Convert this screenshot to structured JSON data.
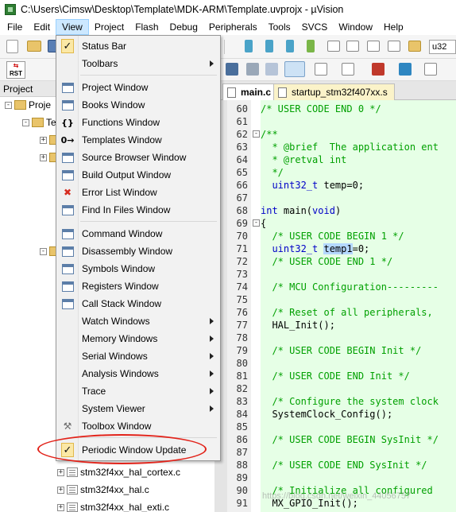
{
  "window": {
    "title": "C:\\Users\\Cimsw\\Desktop\\Template\\MDK-ARM\\Template.uvprojx - µVision"
  },
  "menubar": [
    "File",
    "Edit",
    "View",
    "Project",
    "Flash",
    "Debug",
    "Peripherals",
    "Tools",
    "SVCS",
    "Window",
    "Help"
  ],
  "toolbar": {
    "target_combo": "u32",
    "rst_label": "RST"
  },
  "project_panel": {
    "header": "Project",
    "tree": [
      {
        "label": "Proje",
        "indent": 0,
        "expander": "-"
      },
      {
        "label": "Te",
        "indent": 1,
        "expander": "-"
      },
      {
        "label": "",
        "indent": 2,
        "expander": "+"
      },
      {
        "label": "",
        "indent": 2,
        "expander": "+"
      },
      {
        "label": "",
        "indent": 2,
        "expander": "-"
      },
      {
        "label": "stm32f4xx_hal_cortex.c",
        "indent": 3,
        "expander": "+"
      },
      {
        "label": "stm32f4xx_hal.c",
        "indent": 3,
        "expander": "+"
      },
      {
        "label": "stm32f4xx_hal_exti.c",
        "indent": 3,
        "expander": "+"
      }
    ]
  },
  "tabs": [
    {
      "label": "main.c",
      "active": true
    },
    {
      "label": "startup_stm32f407xx.s",
      "active": false
    }
  ],
  "code": [
    {
      "n": "60",
      "fold": "",
      "parts": [
        [
          "comment",
          "/* USER CODE END 0 */"
        ]
      ]
    },
    {
      "n": "61",
      "fold": "",
      "parts": []
    },
    {
      "n": "62",
      "fold": "-",
      "parts": [
        [
          "comment",
          "/**"
        ]
      ]
    },
    {
      "n": "63",
      "fold": "",
      "parts": [
        [
          "comment",
          "  * @brief  The application ent"
        ]
      ]
    },
    {
      "n": "64",
      "fold": "",
      "parts": [
        [
          "comment",
          "  * @retval int"
        ]
      ]
    },
    {
      "n": "65",
      "fold": "",
      "parts": [
        [
          "comment",
          "  */"
        ]
      ]
    },
    {
      "n": "66",
      "fold": "",
      "parts": [
        [
          "kw",
          "  uint32_t"
        ],
        [
          "plain",
          " temp=0;"
        ]
      ]
    },
    {
      "n": "67",
      "fold": "",
      "parts": []
    },
    {
      "n": "68",
      "fold": "",
      "parts": [
        [
          "kw",
          "int"
        ],
        [
          "plain",
          " main("
        ],
        [
          "kw",
          "void"
        ],
        [
          "plain",
          ")"
        ]
      ]
    },
    {
      "n": "69",
      "fold": "-",
      "parts": [
        [
          "plain",
          "{"
        ]
      ]
    },
    {
      "n": "70",
      "fold": "",
      "parts": [
        [
          "comment",
          "  /* USER CODE BEGIN 1 */"
        ]
      ]
    },
    {
      "n": "71",
      "fold": "",
      "parts": [
        [
          "kw",
          "  uint32_t"
        ],
        [
          "plain",
          " "
        ],
        [
          "hl",
          "temp1"
        ],
        [
          "plain",
          "=0;"
        ]
      ]
    },
    {
      "n": "72",
      "fold": "",
      "parts": [
        [
          "comment",
          "  /* USER CODE END 1 */"
        ]
      ]
    },
    {
      "n": "73",
      "fold": "",
      "parts": []
    },
    {
      "n": "74",
      "fold": "",
      "parts": [
        [
          "comment",
          "  /* MCU Configuration---------"
        ]
      ]
    },
    {
      "n": "75",
      "fold": "",
      "parts": []
    },
    {
      "n": "76",
      "fold": "",
      "parts": [
        [
          "comment",
          "  /* Reset of all peripherals,"
        ]
      ]
    },
    {
      "n": "77",
      "fold": "",
      "parts": [
        [
          "plain",
          "  HAL_Init();"
        ]
      ]
    },
    {
      "n": "78",
      "fold": "",
      "parts": []
    },
    {
      "n": "79",
      "fold": "",
      "parts": [
        [
          "comment",
          "  /* USER CODE BEGIN Init */"
        ]
      ]
    },
    {
      "n": "80",
      "fold": "",
      "parts": []
    },
    {
      "n": "81",
      "fold": "",
      "parts": [
        [
          "comment",
          "  /* USER CODE END Init */"
        ]
      ]
    },
    {
      "n": "82",
      "fold": "",
      "parts": []
    },
    {
      "n": "83",
      "fold": "",
      "parts": [
        [
          "comment",
          "  /* Configure the system clock"
        ]
      ]
    },
    {
      "n": "84",
      "fold": "",
      "parts": [
        [
          "plain",
          "  SystemClock_Config();"
        ]
      ]
    },
    {
      "n": "85",
      "fold": "",
      "parts": []
    },
    {
      "n": "86",
      "fold": "",
      "parts": [
        [
          "comment",
          "  /* USER CODE BEGIN SysInit */"
        ]
      ]
    },
    {
      "n": "87",
      "fold": "",
      "parts": []
    },
    {
      "n": "88",
      "fold": "",
      "parts": [
        [
          "comment",
          "  /* USER CODE END SysInit */"
        ]
      ]
    },
    {
      "n": "89",
      "fold": "",
      "parts": []
    },
    {
      "n": "90",
      "fold": "",
      "parts": [
        [
          "comment",
          "  /* Initialize all configured"
        ]
      ]
    },
    {
      "n": "91",
      "fold": "",
      "parts": [
        [
          "plain",
          "  MX_GPIO_Init();"
        ]
      ]
    }
  ],
  "view_menu": {
    "items": [
      {
        "label": "Status Bar",
        "icon": "check-icon",
        "checked": true,
        "submenu": false
      },
      {
        "label": "Toolbars",
        "icon": "",
        "checked": false,
        "submenu": true
      },
      {
        "sep": true
      },
      {
        "label": "Project Window",
        "icon": "project-window-icon",
        "submenu": false
      },
      {
        "label": "Books Window",
        "icon": "books-window-icon",
        "submenu": false
      },
      {
        "label": "Functions Window",
        "icon": "functions-window-icon",
        "glyph": "{}",
        "submenu": false
      },
      {
        "label": "Templates Window",
        "icon": "templates-window-icon",
        "glyph": "0→",
        "submenu": false
      },
      {
        "label": "Source Browser Window",
        "icon": "source-browser-icon",
        "submenu": false
      },
      {
        "label": "Build Output Window",
        "icon": "build-output-icon",
        "submenu": false
      },
      {
        "label": "Error List Window",
        "icon": "error-list-icon",
        "submenu": false
      },
      {
        "label": "Find In Files Window",
        "icon": "find-in-files-icon",
        "submenu": false
      },
      {
        "sep": true
      },
      {
        "label": "Command Window",
        "icon": "command-window-icon",
        "submenu": false
      },
      {
        "label": "Disassembly Window",
        "icon": "disassembly-window-icon",
        "submenu": false
      },
      {
        "label": "Symbols Window",
        "icon": "symbols-window-icon",
        "submenu": false
      },
      {
        "label": "Registers Window",
        "icon": "registers-window-icon",
        "submenu": false
      },
      {
        "label": "Call Stack Window",
        "icon": "call-stack-window-icon",
        "submenu": false
      },
      {
        "label": "Watch Windows",
        "icon": "",
        "submenu": true
      },
      {
        "label": "Memory Windows",
        "icon": "",
        "submenu": true
      },
      {
        "label": "Serial Windows",
        "icon": "",
        "submenu": true
      },
      {
        "label": "Analysis Windows",
        "icon": "",
        "submenu": true
      },
      {
        "label": "Trace",
        "icon": "",
        "submenu": true
      },
      {
        "label": "System Viewer",
        "icon": "",
        "submenu": true
      },
      {
        "label": "Toolbox Window",
        "icon": "toolbox-icon",
        "submenu": false
      },
      {
        "sep": true
      },
      {
        "label": "Periodic Window Update",
        "icon": "check-icon",
        "checked": true,
        "submenu": false
      }
    ]
  },
  "colors": {
    "comment": "#00a000",
    "keyword": "#0000c8",
    "code_bg": "#e6ffe6",
    "highlight": "#b4d8ff",
    "annotation": "#e2231a"
  },
  "watermark": "https://blog.csdn.net/weixin_44056757"
}
